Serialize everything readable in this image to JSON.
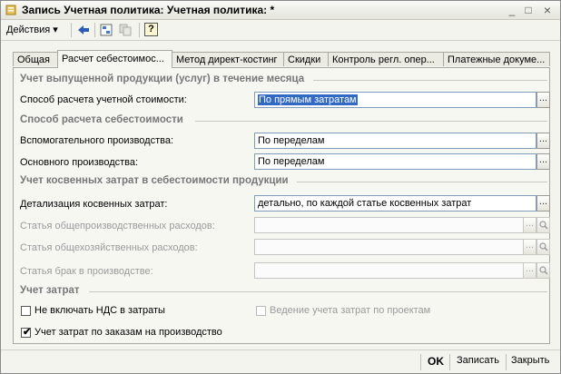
{
  "window": {
    "title": "Запись Учетная политика: Учетная политика: *"
  },
  "toolbar": {
    "actions_label": "Действия",
    "actions_arrow": "▾",
    "help_label": "?"
  },
  "tabs": [
    {
      "label": "Общая",
      "active": false
    },
    {
      "label": "Расчет себестоимос...",
      "active": true
    },
    {
      "label": "Метод директ-костинг",
      "active": false
    },
    {
      "label": "Скидки",
      "active": false
    },
    {
      "label": "Контроль регл. опер...",
      "active": false
    },
    {
      "label": "Платежные докуме...",
      "active": false
    }
  ],
  "sections": {
    "output": "Учет выпущенной продукции (услуг) в течение месяца",
    "cost_method": "Способ расчета себестоимости",
    "indirect": "Учет косвенных затрат в себестоимости продукции",
    "expenses": "Учет затрат"
  },
  "fields": {
    "accounting_cost_method": {
      "label": "Способ расчета учетной стоимости:",
      "value": "По прямым затратам"
    },
    "auxiliary_production": {
      "label": "Вспомогательного производства:",
      "value": "По переделам"
    },
    "main_production": {
      "label": "Основного производства:",
      "value": "По переделам"
    },
    "indirect_detail": {
      "label": "Детализация косвенных затрат:",
      "value": "детально, по каждой статье косвенных затрат"
    },
    "overhead_item": {
      "label": "Статья общепроизводственных расходов:",
      "value": ""
    },
    "general_item": {
      "label": "Статья общехозяйственных расходов:",
      "value": ""
    },
    "defect_item": {
      "label": "Статья брак в производстве:",
      "value": ""
    }
  },
  "checkboxes": {
    "no_vat": {
      "label": "Не включать НДС в затраты",
      "checked": false
    },
    "by_projects": {
      "label": "Ведение учета затрат по проектам",
      "checked": false
    },
    "by_orders": {
      "label": "Учет затрат по заказам на производство",
      "checked": true,
      "mark": "✔"
    }
  },
  "buttons": {
    "dots": "...",
    "ok": "OK",
    "save": "Записать",
    "close": "Закрыть"
  },
  "title_controls": {
    "minimize": "_",
    "maximize": "□",
    "close": "×"
  }
}
